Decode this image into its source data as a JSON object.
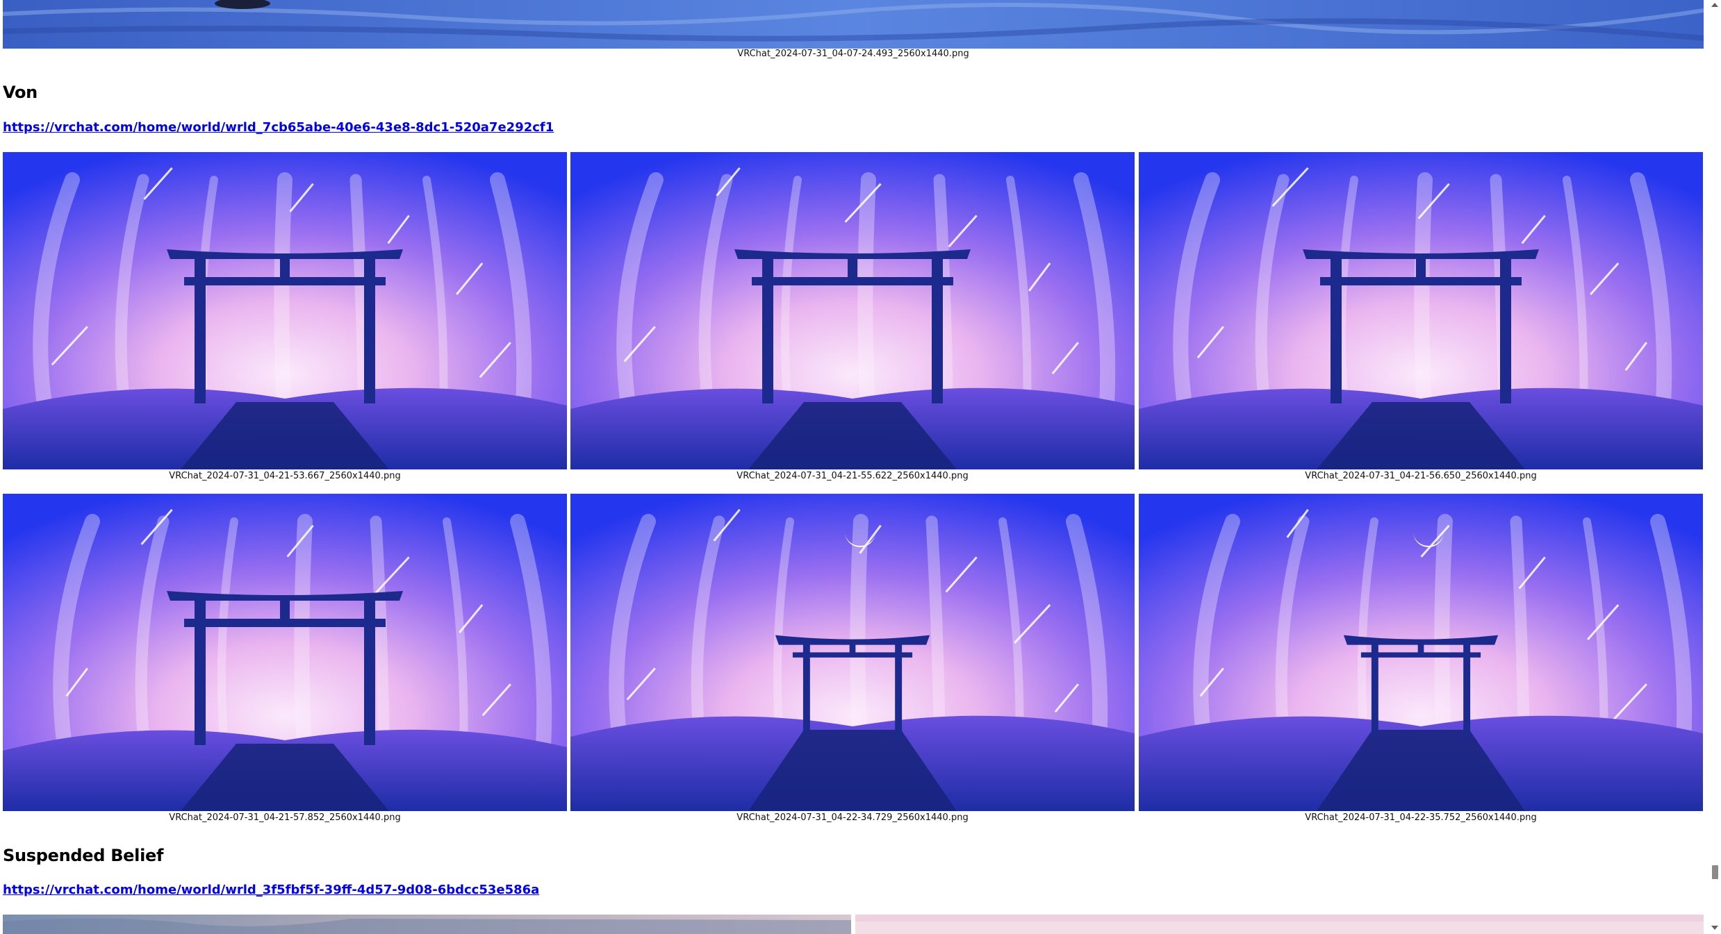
{
  "top_section": {
    "caption": "VRChat_2024-07-31_04-07-24.493_2560x1440.png"
  },
  "sections": [
    {
      "title": "Von",
      "link": "https://vrchat.com/home/world/wrld_7cb65abe-40e6-43e8-8dc1-520a7e292cf1",
      "images": [
        {
          "caption": "VRChat_2024-07-31_04-21-53.667_2560x1440.png",
          "moon": false
        },
        {
          "caption": "VRChat_2024-07-31_04-21-55.622_2560x1440.png",
          "moon": false
        },
        {
          "caption": "VRChat_2024-07-31_04-21-56.650_2560x1440.png",
          "moon": false
        },
        {
          "caption": "VRChat_2024-07-31_04-21-57.852_2560x1440.png",
          "moon": false
        },
        {
          "caption": "VRChat_2024-07-31_04-22-34.729_2560x1440.png",
          "moon": true
        },
        {
          "caption": "VRChat_2024-07-31_04-22-35.752_2560x1440.png",
          "moon": true
        }
      ]
    },
    {
      "title": "Suspended Belief",
      "link": "https://vrchat.com/home/world/wrld_3f5fbf5f-39ff-4d57-9d08-6bdcc53e586a"
    }
  ],
  "colors": {
    "link": "#0000ee",
    "sky_deep": "#2a3cf0",
    "sky_glow": "#f3d2f5",
    "silhouette": "#1b2a8c"
  }
}
